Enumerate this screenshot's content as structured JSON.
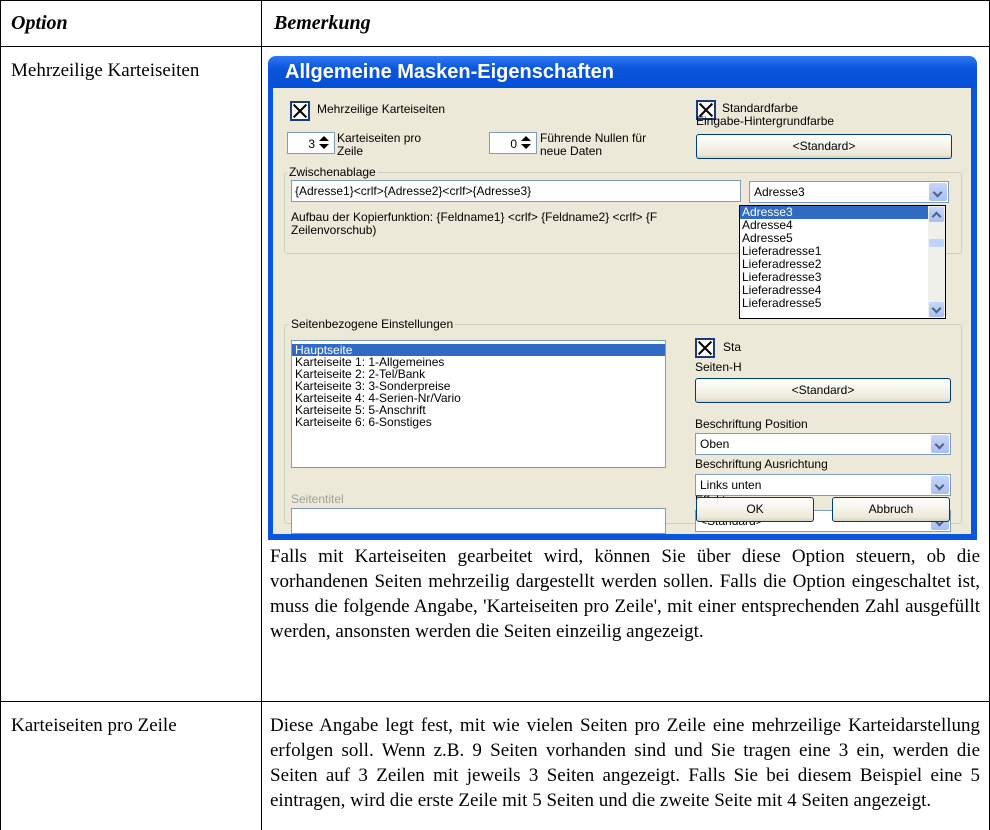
{
  "table": {
    "headers": [
      "Option",
      "Bemerkung"
    ],
    "rows": [
      {
        "option": "Mehrzeilige Karteiseiten",
        "remark": "Falls mit Karteiseiten gearbeitet wird, können Sie über diese Option steuern, ob die vorhandenen Seiten mehrzeilig dargestellt werden sollen. Falls die Option eingeschaltet ist, muss die folgende Angabe, 'Karteiseiten pro Zeile', mit einer entsprechenden Zahl ausgefüllt werden, ansonsten werden die Seiten einzeilig angezeigt."
      },
      {
        "option": "Karteiseiten pro Zeile",
        "remark": "Diese Angabe legt fest, mit wie vielen Seiten pro Zeile eine mehrzeilige Karteidarstellung erfolgen soll. Wenn z.B. 9 Seiten vorhanden sind und Sie tragen eine 3 ein, werden die Seiten auf 3 Zeilen mit jeweils 3 Seiten angezeigt. Falls Sie bei diesem Beispiel eine 5 eintragen, wird die erste Zeile mit 5 Seiten und die zweite Seite mit 4 Seiten angezeigt."
      }
    ]
  },
  "dialog": {
    "title": "Allgemeine Masken-Eigenschaften",
    "multiline_label": "Mehrzeilige Karteiseiten",
    "tabs_per_row_value": "3",
    "tabs_per_row_label_1": "Karteiseiten pro",
    "tabs_per_row_label_2": "Zeile",
    "leading_zeros_value": "0",
    "leading_zeros_label_1": "Führende Nullen für",
    "leading_zeros_label_2": "neue Daten",
    "std_color_label": "Standardfarbe",
    "input_bg_label": "Eingabe-Hintergrundfarbe",
    "standard_button": "<Standard>",
    "clipboard_group": "Zwischenablage",
    "clipboard_value": "{Adresse1}<crlf>{Adresse2}<crlf>{Adresse3}",
    "clipboard_combo": "Adresse3",
    "clipboard_help_1": "Aufbau der Kopierfunktion: {Feldname1} <crlf> {Feldname2} <crlf> {F",
    "clipboard_help_2": "Zeilenvorschub)",
    "dropdown_items": [
      "Adresse3",
      "Adresse4",
      "Adresse5",
      "Lieferadresse1",
      "Lieferadresse2",
      "Lieferadresse3",
      "Lieferadresse4",
      "Lieferadresse5"
    ],
    "page_group": "Seitenbezogene Einstellungen",
    "pages": [
      "Hauptseite",
      "Karteiseite 1: 1-Allgemeines",
      "Karteiseite 2: 2-Tel/Bank",
      "Karteiseite 3: 3-Sonderpreise",
      "Karteiseite 4: 4-Serien-Nr/Vario",
      "Karteiseite 5: 5-Anschrift",
      "Karteiseite 6: 6-Sonstiges"
    ],
    "page_std_label": "Sta",
    "page_bg_label": "Seiten-H",
    "page_standard_button": "<Standard>",
    "label_position": "Beschriftung Position",
    "label_position_value": "Oben",
    "label_alignment": "Beschriftung Ausrichtung",
    "label_alignment_value": "Links unten",
    "effect_label": "Effekt",
    "effect_value": "<Standard>",
    "page_title_label": "Seitentitel",
    "page_title_value": "",
    "ok": "OK",
    "cancel": "Abbruch"
  }
}
